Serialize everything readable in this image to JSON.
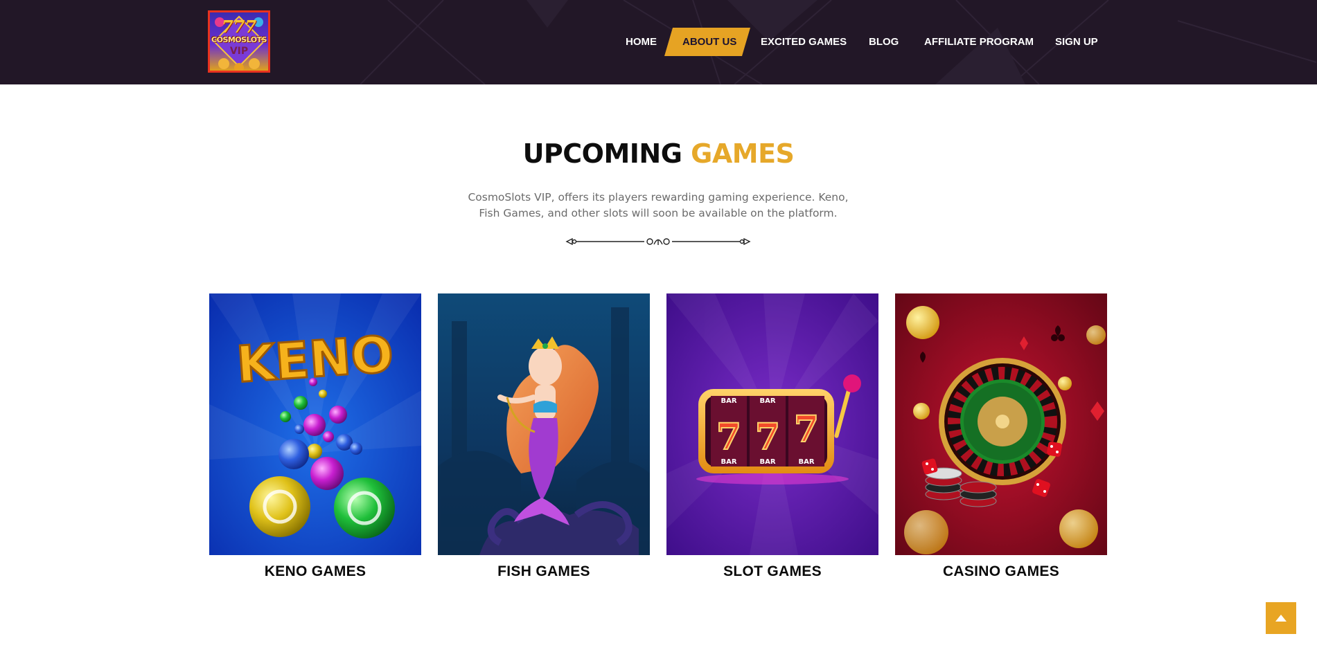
{
  "colors": {
    "header_bg": "#221727",
    "accent": "#e6a82a",
    "title_dark": "#0d0d0d",
    "text_muted": "#6b6b6b",
    "logo_border": "#e8321f"
  },
  "logo": {
    "line1": "777",
    "line2": "COSMOSLOTS",
    "line3": "VIP"
  },
  "nav": {
    "items": [
      {
        "label": "HOME",
        "active": false
      },
      {
        "label": "ABOUT US",
        "active": true
      },
      {
        "label": "EXCITED GAMES",
        "active": false
      },
      {
        "label": "BLOG",
        "active": false
      },
      {
        "label": "AFFILIATE PROGRAM",
        "active": false
      },
      {
        "label": "SIGN UP",
        "active": false
      }
    ]
  },
  "section": {
    "title_part1": "UPCOMING",
    "title_part2": "GAMES",
    "description": "CosmoSlots VIP, offers its players rewarding gaming experience. Keno, Fish Games, and other slots will soon be available on the platform."
  },
  "cards": [
    {
      "label": "KENO GAMES",
      "image_text": "KENO",
      "icon": "keno-balls-image"
    },
    {
      "label": "FISH GAMES",
      "icon": "mermaid-image"
    },
    {
      "label": "SLOT GAMES",
      "icon": "slot-machine-image",
      "reel_text": "BAR"
    },
    {
      "label": "CASINO GAMES",
      "icon": "roulette-wheel-image"
    }
  ],
  "scroll_top": {
    "icon": "arrow-up-icon"
  }
}
